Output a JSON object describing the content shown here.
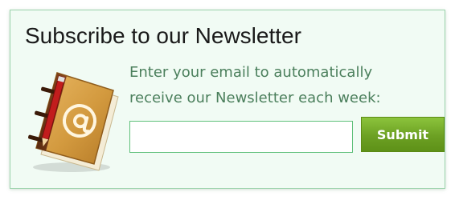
{
  "newsletter": {
    "title": "Subscribe to our Newsletter",
    "description_line1": "Enter your email to automatically",
    "description_line2": "receive our Newsletter each week:",
    "email_input": {
      "value": "",
      "placeholder": ""
    },
    "submit_label": "Submit",
    "icon": "address-book-icon",
    "colors": {
      "border": "#9bd3ab",
      "background": "#f1fbf4",
      "description_text": "#4b7f5c",
      "input_border": "#5fc07a",
      "button": "#6ca023"
    }
  }
}
